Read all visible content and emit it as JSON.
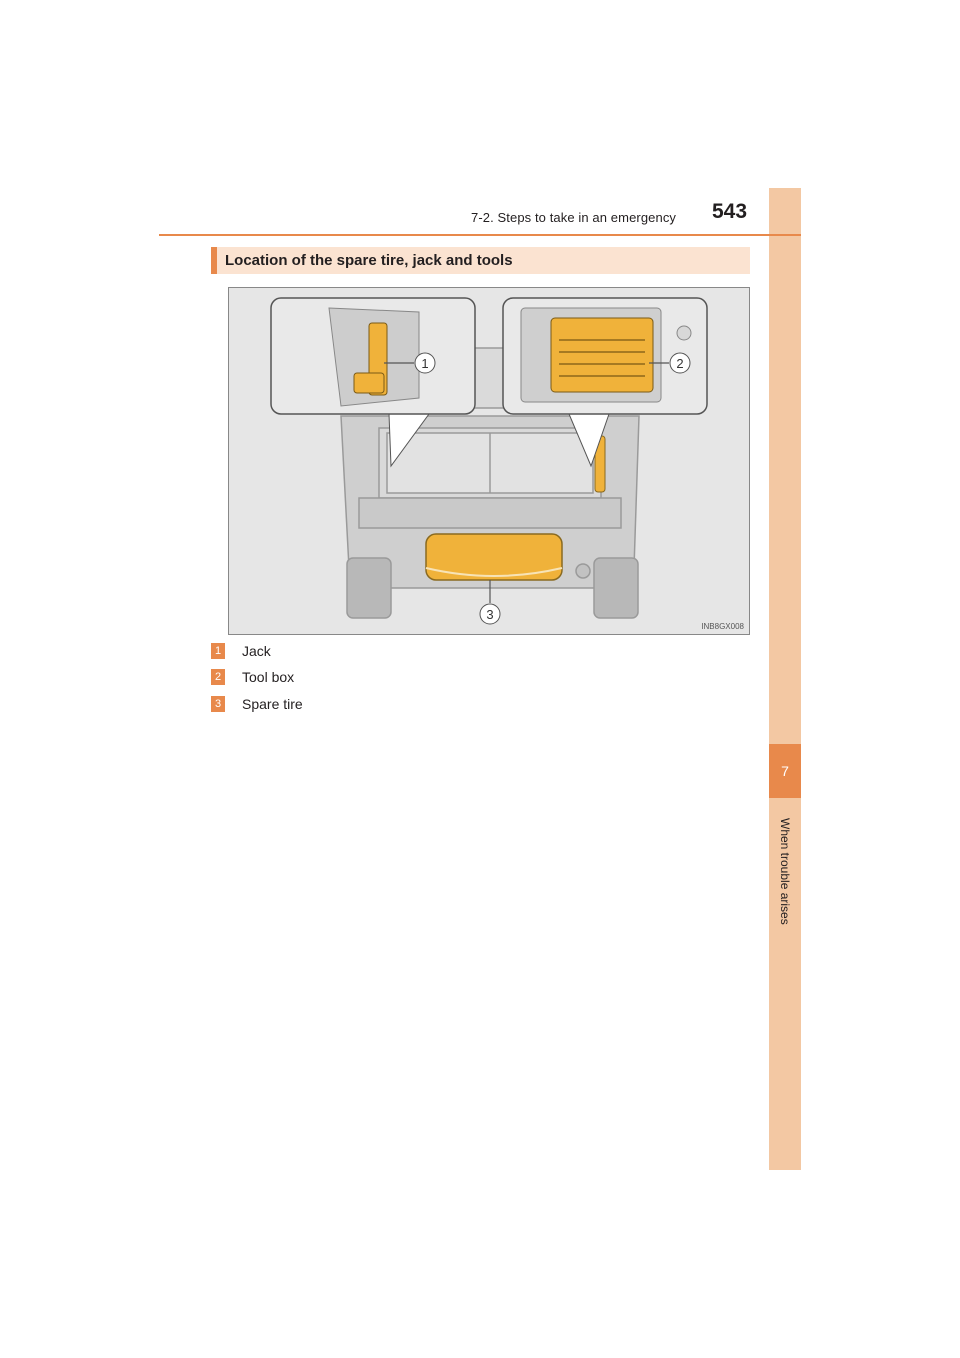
{
  "header": {
    "section": "7-2. Steps to take in an emergency",
    "page_number": "543"
  },
  "side_tab": {
    "chapter_number": "7",
    "chapter_title": "When trouble arises"
  },
  "section": {
    "heading": "Location of the spare tire, jack and tools"
  },
  "figure": {
    "code": "INB8GX008",
    "callouts": [
      "1",
      "2",
      "3"
    ]
  },
  "legend": [
    {
      "num": "1",
      "label": "Jack"
    },
    {
      "num": "2",
      "label": "Tool box"
    },
    {
      "num": "3",
      "label": "Spare tire"
    }
  ],
  "colors": {
    "accent": "#e8894b",
    "tab": "#f3c8a3",
    "heading_bg": "#fbe3d1",
    "highlight": "#f0b23a"
  }
}
